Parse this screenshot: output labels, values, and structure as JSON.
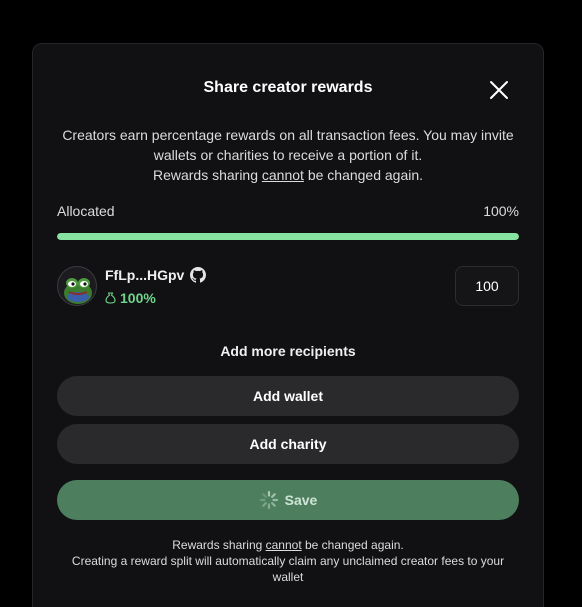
{
  "modal": {
    "title": "Share creator rewards",
    "description": {
      "line1": "Creators earn percentage rewards on all transaction fees. You may invite wallets or charities to receive a portion of it.",
      "line2_before": "Rewards sharing ",
      "line2_emphasis": "cannot",
      "line2_after": " be changed again."
    },
    "allocation": {
      "label": "Allocated",
      "value_text": "100%",
      "progress_percent": 100
    },
    "recipient": {
      "name": "FfLp...HGpv",
      "percent_text": "100%",
      "percent_input_value": "100"
    },
    "add_more_label": "Add more recipients",
    "add_wallet_label": "Add wallet",
    "add_charity_label": "Add charity",
    "save_label": "Save",
    "footer": {
      "line1_before": "Rewards sharing ",
      "line1_emphasis": "cannot",
      "line1_after": " be changed again.",
      "line2": "Creating a reward split will automatically claim any unclaimed creator fees to your wallet"
    }
  },
  "icons": {
    "close": "close-icon",
    "github": "github-icon",
    "money_bag": "money-bag-icon",
    "spinner": "loading-spinner-icon",
    "avatar": "pepe-frog-avatar"
  },
  "colors": {
    "background": "#000000",
    "modal": "#111113",
    "progress": "#86e3a0",
    "percent_text": "#6fd58d",
    "save_button": "#4d7f5f",
    "secondary_button": "#2a2a2d"
  }
}
